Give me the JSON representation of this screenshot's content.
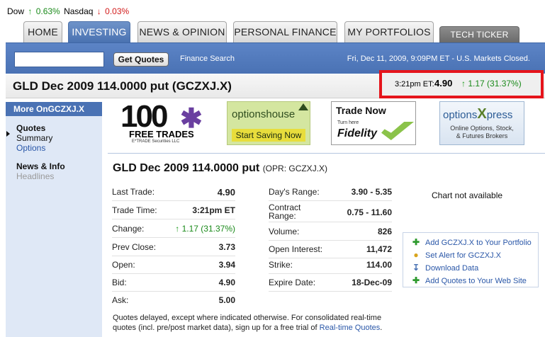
{
  "ticker": {
    "dow_label": "Dow",
    "dow_change": "0.63%",
    "nasdaq_label": "Nasdaq",
    "nasdaq_change": "0.03%"
  },
  "tabs": [
    {
      "label": "HOME"
    },
    {
      "label": "INVESTING"
    },
    {
      "label": "NEWS & OPINION"
    },
    {
      "label": "PERSONAL FINANCE"
    },
    {
      "label": "MY PORTFOLIOS"
    },
    {
      "label": "TECH TICKER"
    }
  ],
  "search": {
    "value": "",
    "button_label": "Get Quotes",
    "finance_search_label": "Finance Search",
    "date_text": "Fri, Dec 11, 2009, 9:09PM ET - U.S. Markets Closed."
  },
  "title": {
    "text": "GLD Dec 2009 114.0000 put (GCZXJ.X)",
    "quote_time": "3:21pm ET:",
    "quote_price": "4.90",
    "quote_change": "1.17 (31.37%)"
  },
  "sidebar": {
    "header": "More OnGCZXJ.X",
    "quotes_heading": "Quotes",
    "quotes_summary": "Summary",
    "quotes_options": "Options",
    "news_heading": "News & Info",
    "news_headlines": "Headlines"
  },
  "ads": {
    "etrade_big": "100",
    "etrade_line1": "FREE TRADES",
    "etrade_line2": "E*TRADE Securities LLC",
    "optionshouse_brand": "optionshouse",
    "optionshouse_cta": "Start Saving Now",
    "fidelity_head": "Trade Now",
    "fidelity_sub": "Turn here",
    "fidelity_brand": "Fidelity",
    "optionsxpress_brand": "options",
    "optionsxpress_x": "X",
    "optionsxpress_brand2": "press",
    "optionsxpress_line1": "Online Options, Stock,",
    "optionsxpress_line2": "& Futures Brokers"
  },
  "detail": {
    "title": "GLD Dec 2009 114.0000 put",
    "symbol": "(OPR: GCZXJ.X)",
    "left_rows": [
      {
        "label": "Last Trade:",
        "value": "4.90"
      },
      {
        "label": "Trade Time:",
        "value": "3:21pm ET"
      },
      {
        "label": "Change:",
        "value": "1.17 (31.37%)"
      },
      {
        "label": "Prev Close:",
        "value": "3.73"
      },
      {
        "label": "Open:",
        "value": "3.94"
      },
      {
        "label": "Bid:",
        "value": "4.90"
      },
      {
        "label": "Ask:",
        "value": "5.00"
      }
    ],
    "right_rows": [
      {
        "label": "Day's Range:",
        "value": "3.90 - 5.35"
      },
      {
        "label": "Contract Range:",
        "value": "0.75 - 11.60"
      },
      {
        "label": "Volume:",
        "value": "826"
      },
      {
        "label": "Open Interest:",
        "value": "11,472"
      },
      {
        "label": "Strike:",
        "value": "114.00"
      },
      {
        "label": "Expire Date:",
        "value": "18-Dec-09"
      }
    ],
    "chart_unavailable": "Chart not available",
    "links": [
      {
        "label": "Add GCZXJ.X to Your Portfolio",
        "icon": "plus-icon"
      },
      {
        "label": "Set Alert for GCZXJ.X",
        "icon": "bell-icon"
      },
      {
        "label": "Download Data",
        "icon": "download-icon"
      },
      {
        "label": "Add Quotes to Your Web Site",
        "icon": "plus-icon"
      }
    ],
    "footer_text": "Quotes delayed, except where indicated otherwise. For consolidated real-time quotes (incl. pre/post market data), sign up for a free trial of",
    "footer_link": "Real-time Quotes",
    "footer_end": "."
  },
  "colors": {
    "up": "#1a8a1a",
    "down": "#d21a1a",
    "nav_blue": "#4a72b4",
    "highlight_red": "#e5141b"
  }
}
